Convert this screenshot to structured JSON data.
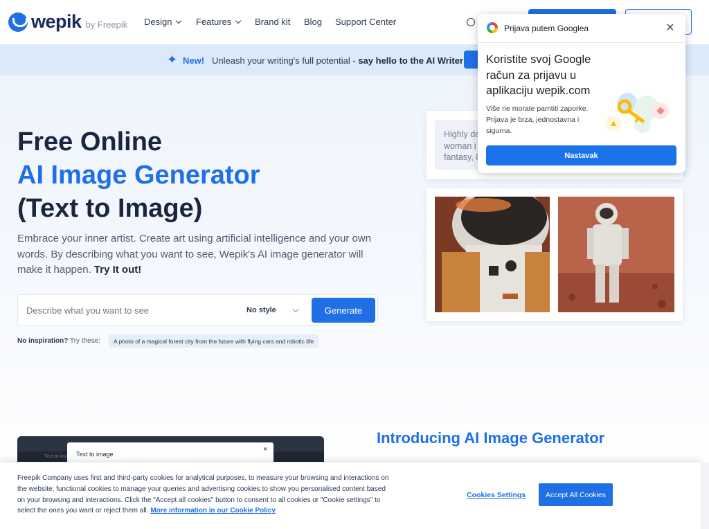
{
  "nav": {
    "logo_text": "wepik",
    "logo_by": "by Freepik",
    "menu": [
      {
        "label": "Design",
        "dropdown": true
      },
      {
        "label": "Features",
        "dropdown": true
      },
      {
        "label": "Brand kit",
        "dropdown": false
      },
      {
        "label": "Blog",
        "dropdown": false
      },
      {
        "label": "Support Center",
        "dropdown": false
      }
    ]
  },
  "banner": {
    "new_label": "New!",
    "text": "Unleash your writing's full potential -",
    "text_bold": "say hello to the AI Writer"
  },
  "hero": {
    "title_line1": "Free Online",
    "title_line2": "AI Image Generator",
    "title_line3": "(Text to Image)",
    "lead": "Embrace your inner artist. Create art using artificial intelligence and your own words. By describing what you want to see, Wepik's AI image generator will make it happen.",
    "lead_cta": "Try It out!",
    "input_placeholder": "Describe what you want to see",
    "style_select": "No style",
    "generate_button": "Generate",
    "inspiration_label": "No inspiration?",
    "inspiration_try": "Try these:",
    "inspiration_chip": "A photo of a magical forest city from the future with flying cars and robotic life",
    "sample_prompt_lines": [
      "Highly de",
      "woman i",
      "fantasy, 8"
    ]
  },
  "section2": {
    "title": "Introducing AI Image Generator",
    "dialog_title": "Text to image",
    "dialog_close": "×",
    "editor_side_text": "Text to ima"
  },
  "google_popup": {
    "header": "Prijava putem Googlea",
    "close": "×",
    "title": "Koristite svoj Google račun za prijavu u aplikaciju wepik.com",
    "body": "Više ne morate pamtiti zaporke. Prijava je brza, jednostavna i sigurna.",
    "button": "Nastavak"
  },
  "cookies": {
    "text": "Freepik Company uses first and third-party cookies for analytical purposes, to measure your browsing and interactions on the website; functional cookies to manage your queries and advertising cookies to show you personalised content based on your browsing and interactions. Click the \"Accept all cookies\" button to consent to all cookies or \"Cookie settings\" to select the ones you want or reject them all.",
    "link": "More information in our Cookie Policy",
    "settings_button": "Cookies Settings",
    "accept_button": "Accept All Cookies"
  },
  "colors": {
    "brand": "#1f6fe5",
    "google_blue": "#1a73e8",
    "banner_bg": "#dce9fb"
  }
}
